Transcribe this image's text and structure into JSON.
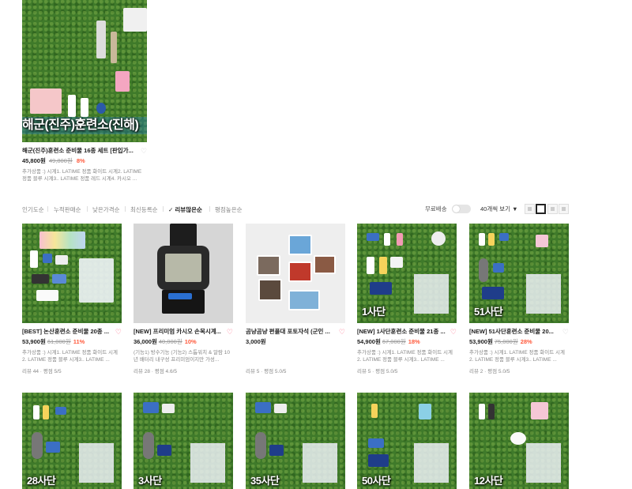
{
  "top_card": {
    "banner_text": "해군(진주)훈련소(진해)",
    "title": "해군(진주)훈련소 준비물 16종 세트 [판입가...",
    "price": "45,800원",
    "old_price": "49,800원",
    "discount": "8%",
    "desc": "추가상품 :) 시계1. LATIME 정품 화이트 시계2. LATIME 정품 블루 시계3.. LATIME 정품 레드 시계4. 카시오 ..."
  },
  "sort": {
    "options": [
      "인기도순",
      "누적판매순",
      "낮은가격순",
      "최신등록순",
      "리뷰많은순",
      "평점높은순"
    ],
    "active_check": "✓",
    "free_shipping_label": "무료배송",
    "per_page": "40개씩 보기",
    "dropdown_arrow": "▼"
  },
  "products_row1": [
    {
      "title": "[BEST] 논산훈련소 준비물 20종 ...",
      "price": "53,900원",
      "old": "61,000원",
      "pct": "11%",
      "desc": "추가상품 :) 시계1. LATIME 정품 화이트 시계2. LATIME 정품 블루 시계3.. LATIME ...",
      "rev": "리뷰 44 · 평점 5/5",
      "label": ""
    },
    {
      "title": "[NEW] 프리미엄 카시오 손목시계...",
      "price": "36,000원",
      "old": "40,000원",
      "pct": "10%",
      "desc": "(기능1) 방수기능 (기능2) 스톱워치 & 알람 10년 배터리 내구성 프리미엄이지만 가성...",
      "rev": "리뷰 28 · 평점 4.6/5",
      "label": ""
    },
    {
      "title": "곰냥곰냥 편플대 포토자석 (군인 ...",
      "price": "3,000원",
      "old": "",
      "pct": "",
      "desc": "",
      "rev": "리뷰 5 · 평점 5.0/5",
      "label": ""
    },
    {
      "title": "[NEW] 1사단훈련소 준비물 21종 ...",
      "price": "54,900원",
      "old": "67,000원",
      "pct": "18%",
      "desc": "추가상품 :) 시계1. LATIME 정품 화이트 시계2. LATIME 정품 블루 시계3.. LATIME ...",
      "rev": "리뷰 5 · 평점 5.0/5",
      "label": "1사단"
    },
    {
      "title": "[NEW] 51사단훈련소 준비물 20...",
      "price": "53,900원",
      "old": "75,000원",
      "pct": "28%",
      "desc": "추가상품 :) 시계1. LATIME 정품 화이트 시계2. LATIME 정품 블루 시계3.. LATIME ...",
      "rev": "리뷰 2 · 평점 5.0/5",
      "label": "51사단"
    }
  ],
  "products_row2": [
    {
      "label": "28사단"
    },
    {
      "label": "3사단"
    },
    {
      "label": "35사단"
    },
    {
      "label": "50사단"
    },
    {
      "label": "12사단"
    }
  ],
  "colors": {
    "accent": "#ff5a3c",
    "heart": "#ff5a7a",
    "grass": "#3f7a2a"
  }
}
